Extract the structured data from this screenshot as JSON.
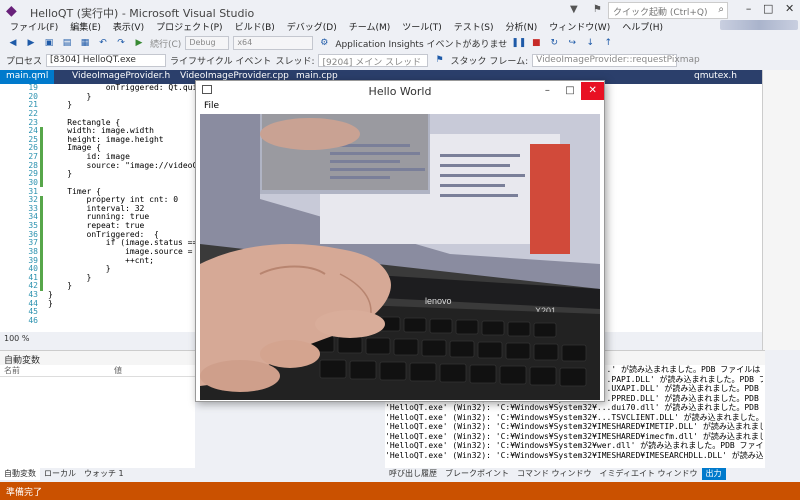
{
  "window": {
    "title": "HelloQT (実行中) - Microsoft Visual Studio",
    "quick_launch_placeholder": "クイック起動 (Ctrl+Q)"
  },
  "menu": [
    "ファイル(F)",
    "編集(E)",
    "表示(V)",
    "プロジェクト(P)",
    "ビルド(B)",
    "デバッグ(D)",
    "チーム(M)",
    "ツール(T)",
    "テスト(S)",
    "分析(N)",
    "ウィンドウ(W)",
    "ヘルプ(H)"
  ],
  "toolbar": {
    "continue_label": "続行(C)",
    "config": "Debug",
    "platform": "x64",
    "insights": "Application Insights イベントがありませ"
  },
  "toolbar2": {
    "process_label": "プロセス",
    "process_value": "[8304] HelloQT.exe",
    "lifecycle": "ライフサイクル イベント",
    "thread_label": "スレッド:",
    "thread_value": "[9204] メイン スレッド",
    "stack_label": "スタック フレーム:",
    "stack_value": "VideoImageProvider::requestPixmap"
  },
  "tabs": [
    "main.qml",
    "VideoImageProvider.h",
    "VideoImageProvider.cpp",
    "main.cpp",
    "qmutex.h"
  ],
  "editor": {
    "line_numbers": [
      "19",
      "20",
      "21",
      "22",
      "23",
      "24",
      "25",
      "26",
      "27",
      "28",
      "29",
      "30",
      "31",
      "32",
      "33",
      "34",
      "35",
      "36",
      "37",
      "38",
      "39",
      "40",
      "41",
      "42",
      "43",
      "44",
      "45",
      "46"
    ],
    "lines": [
      "            onTriggered: Qt.quit",
      "        }",
      "    }",
      "",
      "    Rectangle {",
      "    width: image.width",
      "    height: image.height",
      "    Image {",
      "        id: image",
      "        source: \"image://videoCapture",
      "    }",
      "",
      "    Timer {",
      "        property int cnt: 0",
      "        interval: 32",
      "        running: true",
      "        repeat: true",
      "        onTriggered:  {",
      "            if (image.status ===",
      "                image.source = \"im",
      "                ++cnt;",
      "            }",
      "        }",
      "    }",
      "}",
      "}",
      "",
      ""
    ],
    "zoom": "100 %"
  },
  "locals": {
    "title": "自動変数",
    "col_name": "名前",
    "col_value": "値"
  },
  "bottom_tabs": [
    "自動変数",
    "ローカル",
    "ウォッチ 1"
  ],
  "output": {
    "lines": [
      "'HelloQT.exe' (Win32): 'C:¥Windows¥System32¥...' が読み込まれました。PDB ファイルは",
      "'HelloQT.exe' (Win32): 'C:¥Windows¥System32¥...PAPI.DLL' が読み込まれました。PDB ファイ",
      "'HelloQT.exe' (Win32): 'C:¥Windows¥System32¥...UXAPI.DLL' が読み込まれました。PDB ファイ",
      "'HelloQT.exe' (Win32): 'C:¥Windows¥System32¥...PPRED.DLL' が読み込まれました。PDB ファイ",
      "'HelloQT.exe' (Win32): 'C:¥Windows¥System32¥...dui70.dll' が読み込まれました。PDB ファイルを開けない",
      "'HelloQT.exe' (Win32): 'C:¥Windows¥System32¥...TSVCLIENT.DLL' が読み込まれました。PDB ファ",
      "'HelloQT.exe' (Win32): 'C:¥Windows¥System32¥IMESHARED¥IMETIP.DLL' が読み込まれました。PDB ファイ",
      "'HelloQT.exe' (Win32): 'C:¥Windows¥System32¥IMESHARED¥imecfm.dll' が読み込まれました。PDB ファイ",
      "'HelloQT.exe' (Win32): 'C:¥Windows¥System32¥wer.dll' が読み込まれました。PDB ファイルを開けないか",
      "'HelloQT.exe' (Win32): 'C:¥Windows¥System32¥IMESHARED¥IMESEARCHDLL.DLL' が読み込まれました。PDB"
    ]
  },
  "output_tabs": [
    "呼び出し履歴",
    "ブレークポイント",
    "コマンド ウィンドウ",
    "イミディエイト ウィンドウ",
    "出力"
  ],
  "status": "準備完了",
  "qt_window": {
    "title": "Hello World",
    "menu_file": "File",
    "laptop_brand": "lenovo",
    "laptop_model": "X201"
  },
  "colors": {
    "accent": "#007acc",
    "status_bar": "#ca5100",
    "tab_bar": "#2b3f6b",
    "close": "#e81123"
  }
}
